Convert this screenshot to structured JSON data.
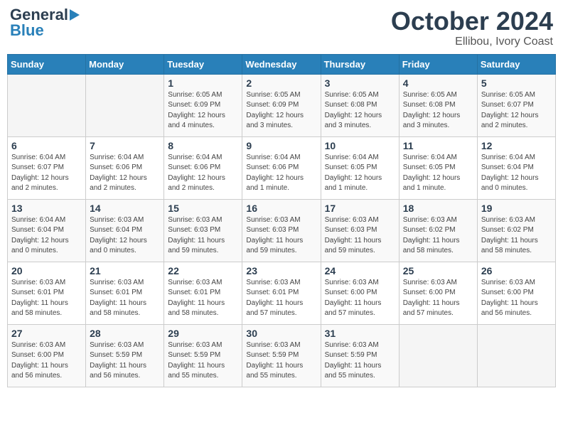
{
  "header": {
    "logo_general": "General",
    "logo_blue": "Blue",
    "month": "October 2024",
    "location": "Ellibou, Ivory Coast"
  },
  "weekdays": [
    "Sunday",
    "Monday",
    "Tuesday",
    "Wednesday",
    "Thursday",
    "Friday",
    "Saturday"
  ],
  "weeks": [
    [
      {
        "day": "",
        "info": ""
      },
      {
        "day": "",
        "info": ""
      },
      {
        "day": "1",
        "info": "Sunrise: 6:05 AM\nSunset: 6:09 PM\nDaylight: 12 hours and 4 minutes."
      },
      {
        "day": "2",
        "info": "Sunrise: 6:05 AM\nSunset: 6:09 PM\nDaylight: 12 hours and 3 minutes."
      },
      {
        "day": "3",
        "info": "Sunrise: 6:05 AM\nSunset: 6:08 PM\nDaylight: 12 hours and 3 minutes."
      },
      {
        "day": "4",
        "info": "Sunrise: 6:05 AM\nSunset: 6:08 PM\nDaylight: 12 hours and 3 minutes."
      },
      {
        "day": "5",
        "info": "Sunrise: 6:05 AM\nSunset: 6:07 PM\nDaylight: 12 hours and 2 minutes."
      }
    ],
    [
      {
        "day": "6",
        "info": "Sunrise: 6:04 AM\nSunset: 6:07 PM\nDaylight: 12 hours and 2 minutes."
      },
      {
        "day": "7",
        "info": "Sunrise: 6:04 AM\nSunset: 6:06 PM\nDaylight: 12 hours and 2 minutes."
      },
      {
        "day": "8",
        "info": "Sunrise: 6:04 AM\nSunset: 6:06 PM\nDaylight: 12 hours and 2 minutes."
      },
      {
        "day": "9",
        "info": "Sunrise: 6:04 AM\nSunset: 6:06 PM\nDaylight: 12 hours and 1 minute."
      },
      {
        "day": "10",
        "info": "Sunrise: 6:04 AM\nSunset: 6:05 PM\nDaylight: 12 hours and 1 minute."
      },
      {
        "day": "11",
        "info": "Sunrise: 6:04 AM\nSunset: 6:05 PM\nDaylight: 12 hours and 1 minute."
      },
      {
        "day": "12",
        "info": "Sunrise: 6:04 AM\nSunset: 6:04 PM\nDaylight: 12 hours and 0 minutes."
      }
    ],
    [
      {
        "day": "13",
        "info": "Sunrise: 6:04 AM\nSunset: 6:04 PM\nDaylight: 12 hours and 0 minutes."
      },
      {
        "day": "14",
        "info": "Sunrise: 6:03 AM\nSunset: 6:04 PM\nDaylight: 12 hours and 0 minutes."
      },
      {
        "day": "15",
        "info": "Sunrise: 6:03 AM\nSunset: 6:03 PM\nDaylight: 11 hours and 59 minutes."
      },
      {
        "day": "16",
        "info": "Sunrise: 6:03 AM\nSunset: 6:03 PM\nDaylight: 11 hours and 59 minutes."
      },
      {
        "day": "17",
        "info": "Sunrise: 6:03 AM\nSunset: 6:03 PM\nDaylight: 11 hours and 59 minutes."
      },
      {
        "day": "18",
        "info": "Sunrise: 6:03 AM\nSunset: 6:02 PM\nDaylight: 11 hours and 58 minutes."
      },
      {
        "day": "19",
        "info": "Sunrise: 6:03 AM\nSunset: 6:02 PM\nDaylight: 11 hours and 58 minutes."
      }
    ],
    [
      {
        "day": "20",
        "info": "Sunrise: 6:03 AM\nSunset: 6:01 PM\nDaylight: 11 hours and 58 minutes."
      },
      {
        "day": "21",
        "info": "Sunrise: 6:03 AM\nSunset: 6:01 PM\nDaylight: 11 hours and 58 minutes."
      },
      {
        "day": "22",
        "info": "Sunrise: 6:03 AM\nSunset: 6:01 PM\nDaylight: 11 hours and 58 minutes."
      },
      {
        "day": "23",
        "info": "Sunrise: 6:03 AM\nSunset: 6:01 PM\nDaylight: 11 hours and 57 minutes."
      },
      {
        "day": "24",
        "info": "Sunrise: 6:03 AM\nSunset: 6:00 PM\nDaylight: 11 hours and 57 minutes."
      },
      {
        "day": "25",
        "info": "Sunrise: 6:03 AM\nSunset: 6:00 PM\nDaylight: 11 hours and 57 minutes."
      },
      {
        "day": "26",
        "info": "Sunrise: 6:03 AM\nSunset: 6:00 PM\nDaylight: 11 hours and 56 minutes."
      }
    ],
    [
      {
        "day": "27",
        "info": "Sunrise: 6:03 AM\nSunset: 6:00 PM\nDaylight: 11 hours and 56 minutes."
      },
      {
        "day": "28",
        "info": "Sunrise: 6:03 AM\nSunset: 5:59 PM\nDaylight: 11 hours and 56 minutes."
      },
      {
        "day": "29",
        "info": "Sunrise: 6:03 AM\nSunset: 5:59 PM\nDaylight: 11 hours and 55 minutes."
      },
      {
        "day": "30",
        "info": "Sunrise: 6:03 AM\nSunset: 5:59 PM\nDaylight: 11 hours and 55 minutes."
      },
      {
        "day": "31",
        "info": "Sunrise: 6:03 AM\nSunset: 5:59 PM\nDaylight: 11 hours and 55 minutes."
      },
      {
        "day": "",
        "info": ""
      },
      {
        "day": "",
        "info": ""
      }
    ]
  ]
}
